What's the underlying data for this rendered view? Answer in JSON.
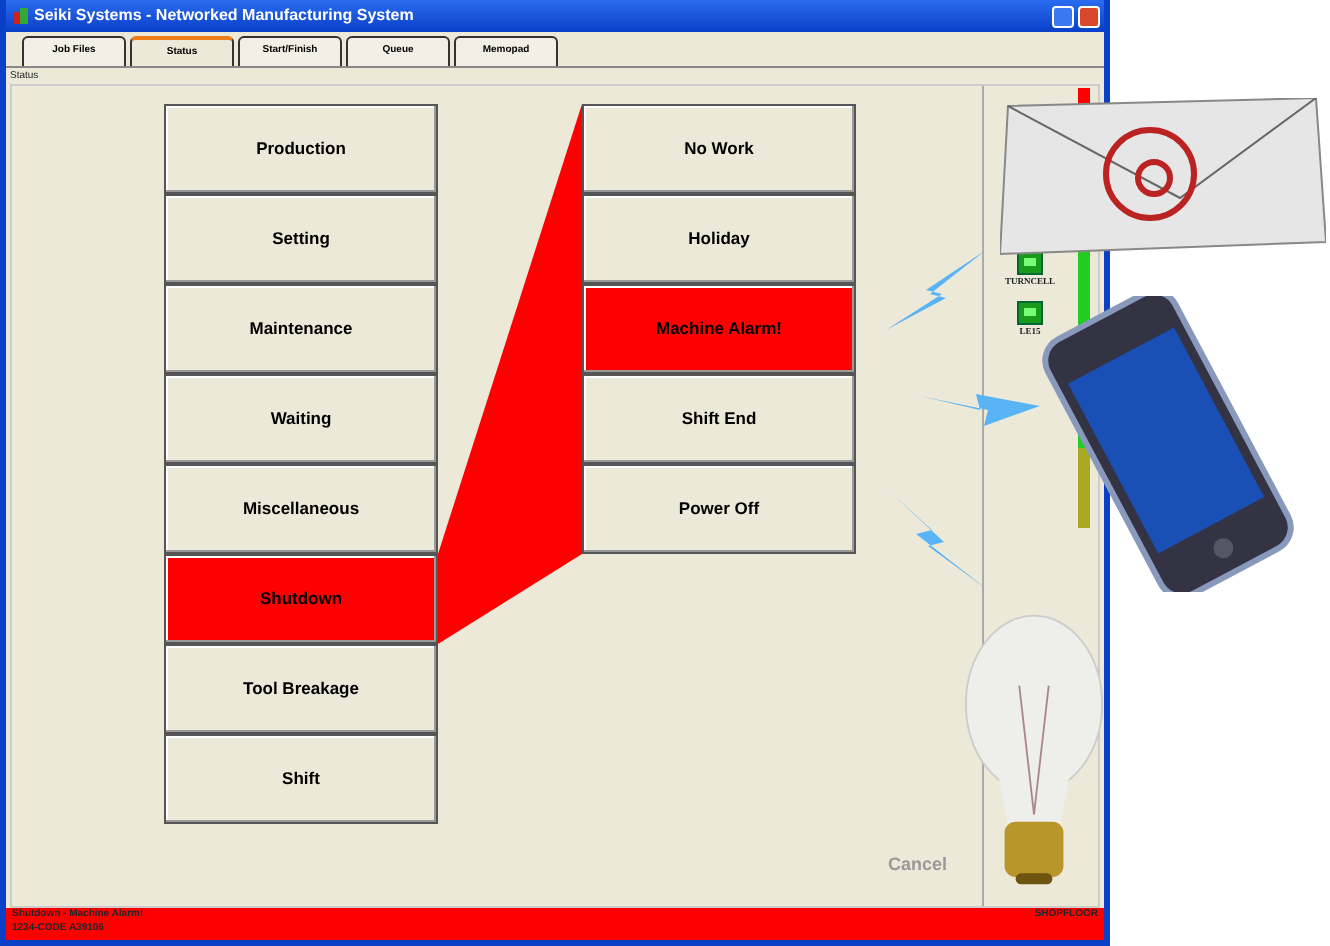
{
  "window": {
    "title": "Seiki Systems - Networked Manufacturing System"
  },
  "tabs": [
    {
      "label": "Job Files",
      "selected": false
    },
    {
      "label": "Status",
      "selected": true
    },
    {
      "label": "Start/Finish",
      "selected": false
    },
    {
      "label": "Queue",
      "selected": false
    },
    {
      "label": "Memopad",
      "selected": false
    }
  ],
  "section_label": "Status",
  "status_buttons": [
    {
      "label": "Production",
      "selected": false
    },
    {
      "label": "Setting",
      "selected": false
    },
    {
      "label": "Maintenance",
      "selected": false
    },
    {
      "label": "Waiting",
      "selected": false
    },
    {
      "label": "Miscellaneous",
      "selected": false
    },
    {
      "label": "Shutdown",
      "selected": true
    },
    {
      "label": "Tool Breakage",
      "selected": false
    },
    {
      "label": "Shift",
      "selected": false
    }
  ],
  "reason_buttons": [
    {
      "label": "No Work",
      "selected": false
    },
    {
      "label": "Holiday",
      "selected": false
    },
    {
      "label": "Machine Alarm!",
      "selected": true
    },
    {
      "label": "Shift End",
      "selected": false
    },
    {
      "label": "Power Off",
      "selected": false
    }
  ],
  "machines": [
    {
      "label": "TURNCELL"
    },
    {
      "label": "LE15"
    }
  ],
  "cancel": {
    "label": "Cancel",
    "disabled": true
  },
  "status_bar": {
    "lines": [
      "Shutdown - Machine Alarm!",
      "1234-CODE A39106"
    ],
    "right": "SHOPFLOOR"
  }
}
